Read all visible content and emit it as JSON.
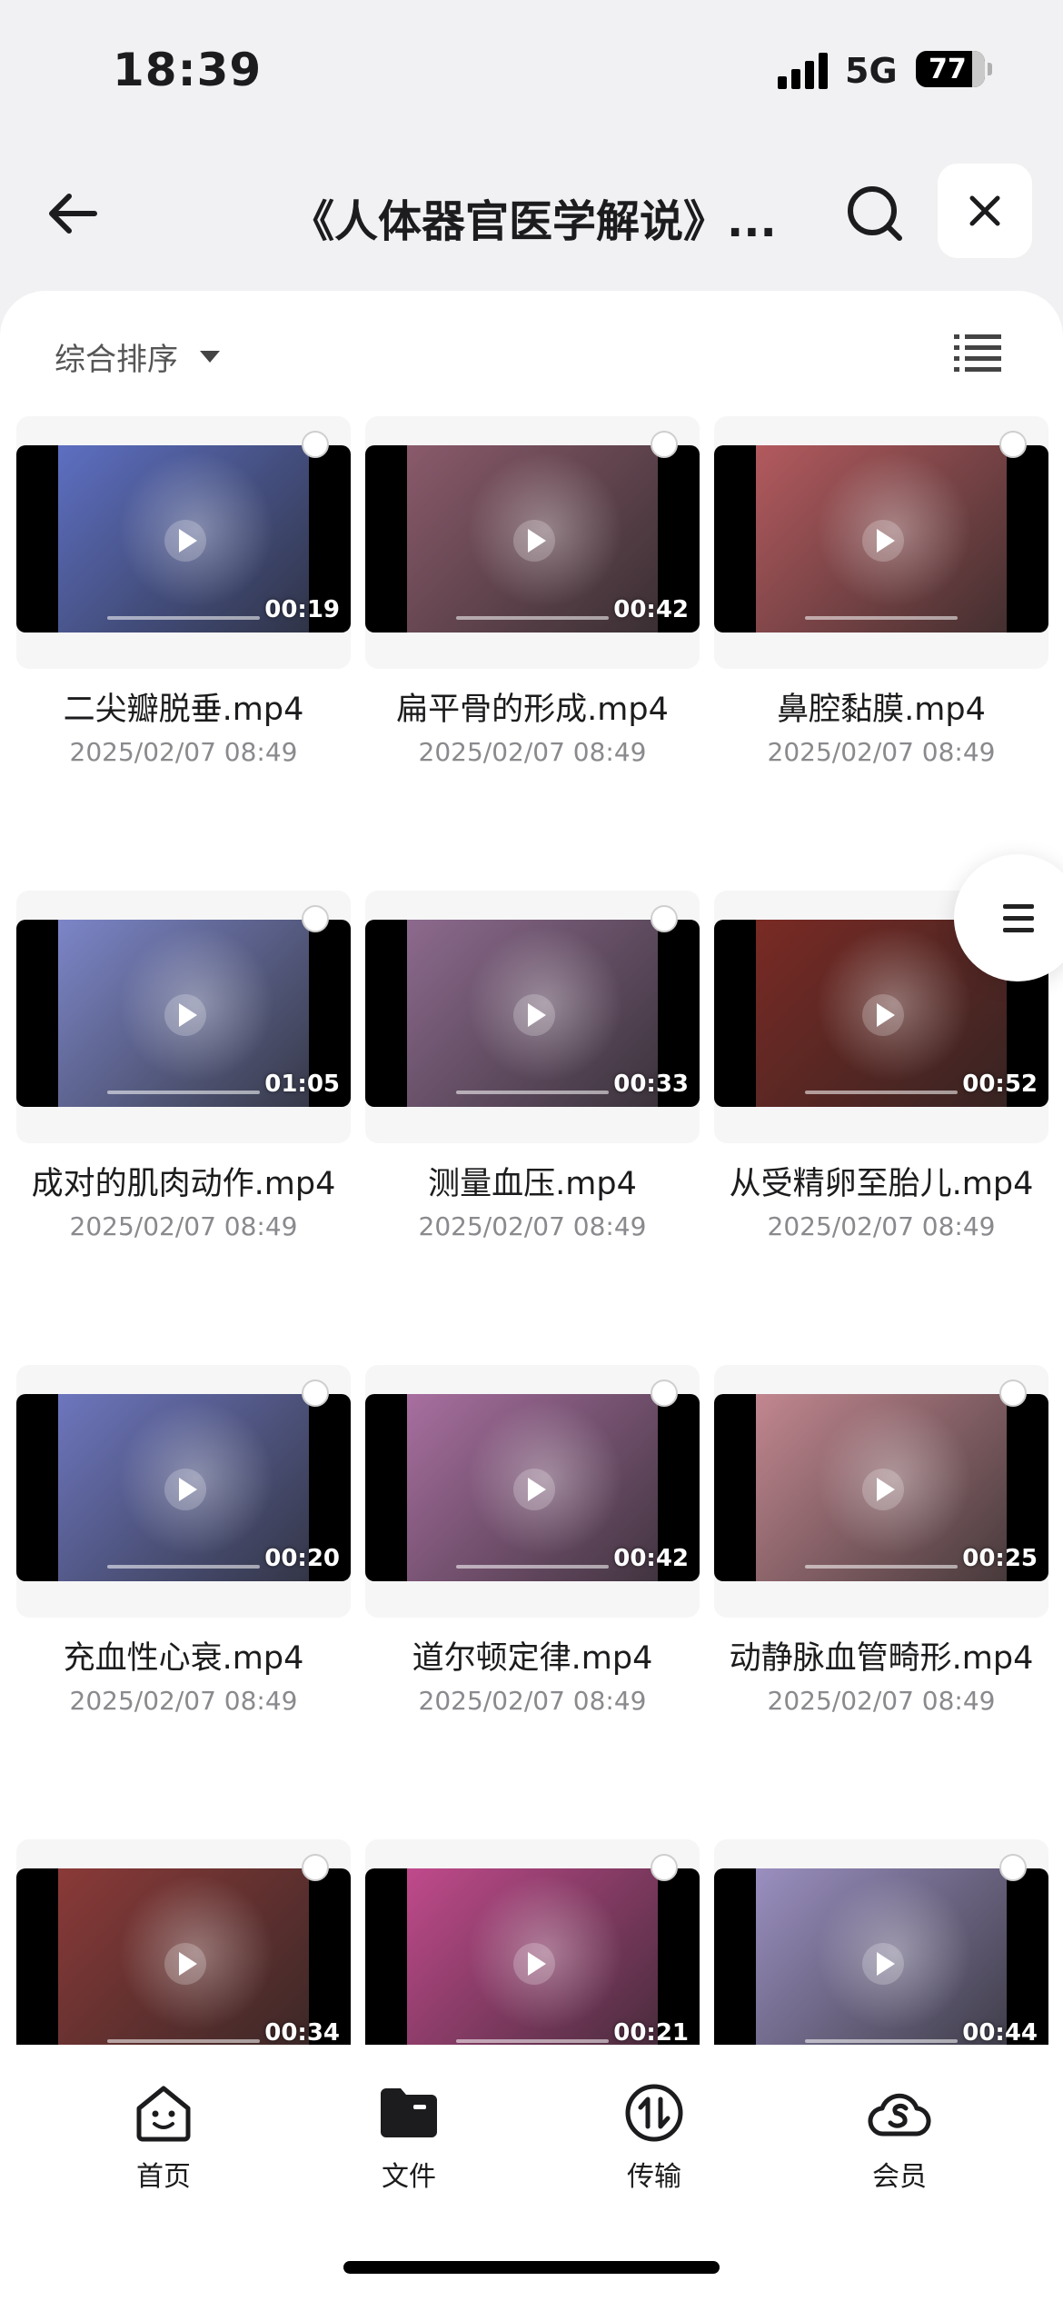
{
  "status_bar": {
    "time": "18:39",
    "network": "5G",
    "battery": "77"
  },
  "header": {
    "title": "《人体器官医学解说》..."
  },
  "sort": {
    "label": "综合排序"
  },
  "files": [
    {
      "name": "二尖瓣脱垂.mp4",
      "date": "2025/02/07 08:49",
      "duration": "00:19",
      "color": "#5d6fc2"
    },
    {
      "name": "扁平骨的形成.mp4",
      "date": "2025/02/07 08:49",
      "duration": "00:42",
      "color": "#8a5a6b"
    },
    {
      "name": "鼻腔黏膜.mp4",
      "date": "2025/02/07 08:49",
      "duration": "",
      "color": "#b35a5e"
    },
    {
      "name": "成对的肌肉动作.mp4",
      "date": "2025/02/07 08:49",
      "duration": "01:05",
      "color": "#7c86c8"
    },
    {
      "name": "测量血压.mp4",
      "date": "2025/02/07 08:49",
      "duration": "00:33",
      "color": "#8d6a8e"
    },
    {
      "name": "从受精卵至胎儿.mp4",
      "date": "2025/02/07 08:49",
      "duration": "00:52",
      "color": "#7a2a24"
    },
    {
      "name": "充血性心衰.mp4",
      "date": "2025/02/07 08:49",
      "duration": "00:20",
      "color": "#6d76be"
    },
    {
      "name": "道尔顿定律.mp4",
      "date": "2025/02/07 08:49",
      "duration": "00:42",
      "color": "#a86fa0"
    },
    {
      "name": "动静脉血管畸形.mp4",
      "date": "2025/02/07 08:49",
      "duration": "00:25",
      "color": "#c28790"
    },
    {
      "name": "",
      "date": "",
      "duration": "00:34",
      "color": "#8a3a38"
    },
    {
      "name": "",
      "date": "",
      "duration": "00:21",
      "color": "#c04a8c"
    },
    {
      "name": "",
      "date": "",
      "duration": "00:44",
      "color": "#9a8fc0"
    }
  ],
  "tabs": [
    {
      "label": "首页"
    },
    {
      "label": "文件"
    },
    {
      "label": "传输"
    },
    {
      "label": "会员"
    }
  ]
}
